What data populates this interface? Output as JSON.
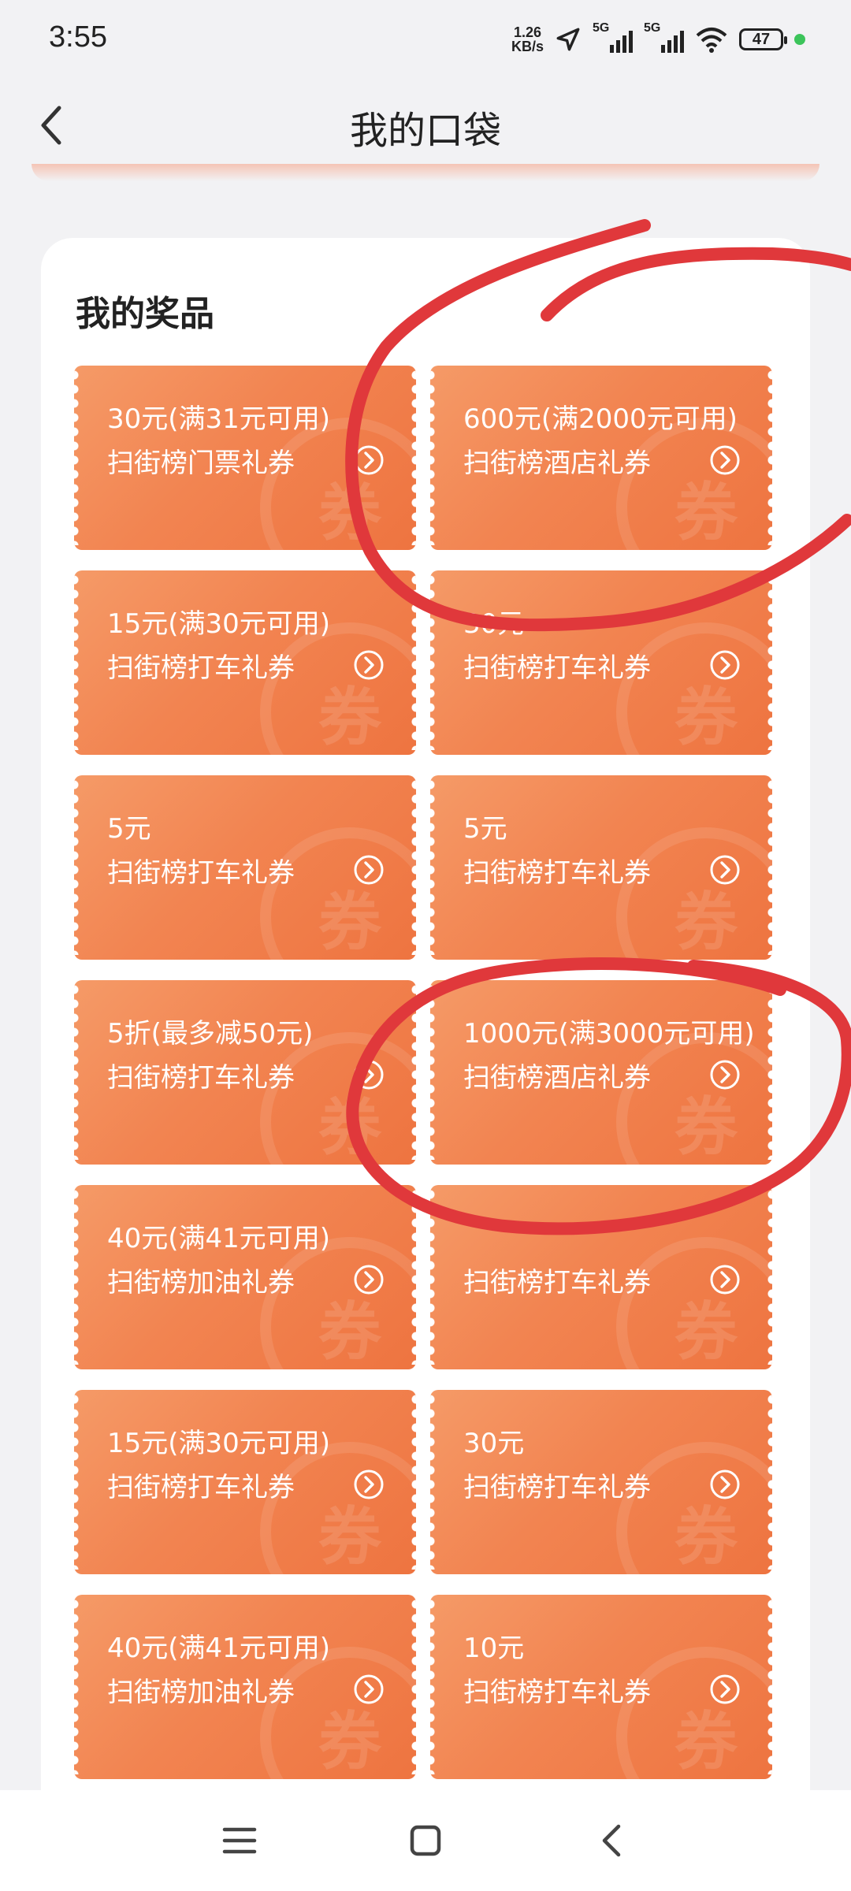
{
  "status_bar": {
    "time": "3:55",
    "net_speed_value": "1.26",
    "net_speed_unit": "KB/s",
    "sim1": "5G",
    "sim2": "5G",
    "battery": "47"
  },
  "header": {
    "title": "我的口袋"
  },
  "prizes": {
    "section_title": "我的奖品",
    "watermark": "券",
    "coupons": [
      {
        "amount": "30元(满31元可用)",
        "type": "扫街榜门票礼券"
      },
      {
        "amount": "600元(满2000元可用)",
        "type": "扫街榜酒店礼券"
      },
      {
        "amount": "15元(满30元可用)",
        "type": "扫街榜打车礼券"
      },
      {
        "amount": "30元",
        "type": "扫街榜打车礼券"
      },
      {
        "amount": "5元",
        "type": "扫街榜打车礼券"
      },
      {
        "amount": "5元",
        "type": "扫街榜打车礼券"
      },
      {
        "amount": "5折(最多减50元)",
        "type": "扫街榜打车礼券"
      },
      {
        "amount": "1000元(满3000元可用)",
        "type": "扫街榜酒店礼券"
      },
      {
        "amount": "40元(满41元可用)",
        "type": "扫街榜加油礼券"
      },
      {
        "amount": "",
        "type": "扫街榜打车礼券"
      },
      {
        "amount": "15元(满30元可用)",
        "type": "扫街榜打车礼券"
      },
      {
        "amount": "30元",
        "type": "扫街榜打车礼券"
      },
      {
        "amount": "40元(满41元可用)",
        "type": "扫街榜加油礼券"
      },
      {
        "amount": "10元",
        "type": "扫街榜打车礼券"
      }
    ]
  },
  "nav_bar": {
    "icons": [
      "menu-icon",
      "home-icon",
      "back-icon"
    ]
  },
  "colors": {
    "coupon_orange": "#f28451",
    "annotation_red": "#e0383b"
  }
}
